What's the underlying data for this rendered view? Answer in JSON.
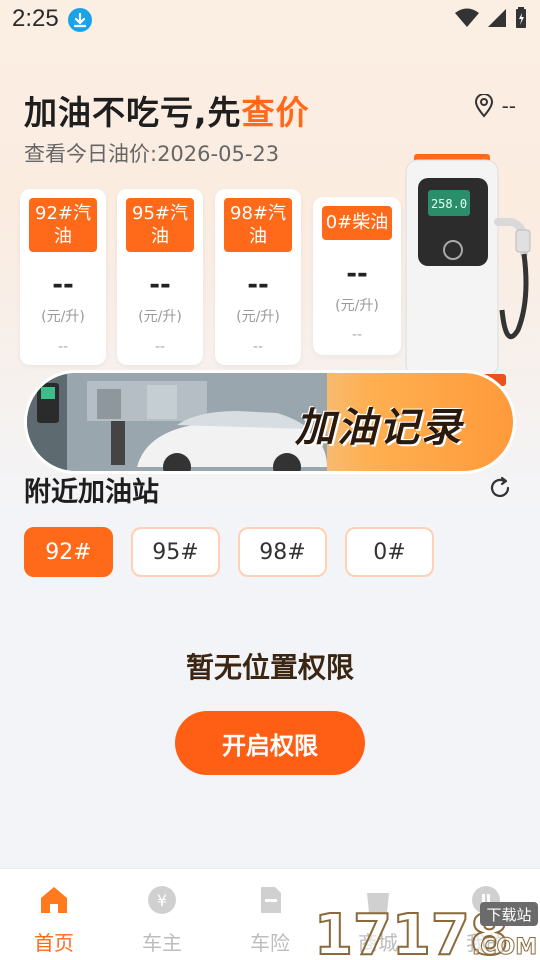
{
  "status_bar": {
    "time": "2:25"
  },
  "header": {
    "headline_pre": "加油不吃亏,先",
    "headline_highlight": "查价",
    "location_value": "--",
    "date_line": "查看今日油价:2026-05-23"
  },
  "prices": [
    {
      "label": "92#汽油",
      "price": "--",
      "unit": "(元/升)",
      "extra": "--"
    },
    {
      "label": "95#汽油",
      "price": "--",
      "unit": "(元/升)",
      "extra": "--"
    },
    {
      "label": "98#汽油",
      "price": "--",
      "unit": "(元/升)",
      "extra": "--"
    },
    {
      "label": "0#柴油",
      "price": "--",
      "unit": "(元/升)",
      "extra": "--"
    }
  ],
  "pump_display": "258.0",
  "banner": {
    "title": "加油记录"
  },
  "nearby": {
    "title": "附近加油站",
    "fuel_tabs": [
      "92#",
      "95#",
      "98#",
      "0#"
    ],
    "active_tab": "92#",
    "empty_message": "暂无位置权限",
    "enable_button": "开启权限"
  },
  "bottom_nav": [
    {
      "label": "首页",
      "icon": "home-icon",
      "active": true
    },
    {
      "label": "车主",
      "icon": "yuan-icon",
      "active": false
    },
    {
      "label": "车险",
      "icon": "document-icon",
      "active": false
    },
    {
      "label": "商城",
      "icon": "bag-icon",
      "active": false
    },
    {
      "label": "我的",
      "icon": "user-icon",
      "active": false
    }
  ],
  "watermark": {
    "site": "17178",
    "suffix": ".COM",
    "badge": "下载站"
  },
  "colors": {
    "accent": "#ff6a1a",
    "button": "#ff5f14",
    "background": "#f3f4f8"
  }
}
